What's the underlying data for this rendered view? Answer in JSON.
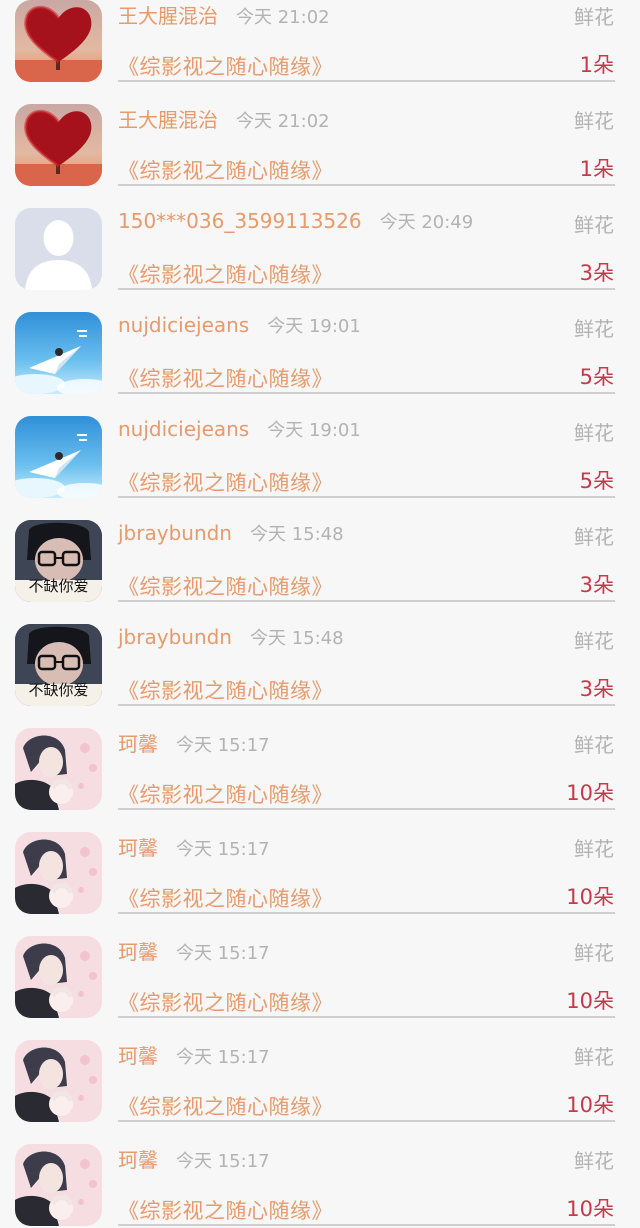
{
  "gift_list": {
    "rows": [
      {
        "user": "王大腥混治",
        "time": "今天 21:02",
        "gift": "鲜花",
        "book": "《综影视之随心随缘》",
        "amount": "1朵",
        "avatar": "heart-tree"
      },
      {
        "user": "王大腥混治",
        "time": "今天 21:02",
        "gift": "鲜花",
        "book": "《综影视之随心随缘》",
        "amount": "1朵",
        "avatar": "heart-tree"
      },
      {
        "user": "150***036_3599113526",
        "time": "今天 20:49",
        "gift": "鲜花",
        "book": "《综影视之随心随缘》",
        "amount": "3朵",
        "avatar": "default-person"
      },
      {
        "user": "nujdiciejeans",
        "time": "今天 19:01",
        "gift": "鲜花",
        "book": "《综影视之随心随缘》",
        "amount": "5朵",
        "avatar": "paper-plane"
      },
      {
        "user": "nujdiciejeans",
        "time": "今天 19:01",
        "gift": "鲜花",
        "book": "《综影视之随心随缘》",
        "amount": "5朵",
        "avatar": "paper-plane"
      },
      {
        "user": "jbraybundn",
        "time": "今天 15:48",
        "gift": "鲜花",
        "book": "《综影视之随心随缘》",
        "amount": "3朵",
        "avatar": "glasses-girl"
      },
      {
        "user": "jbraybundn",
        "time": "今天 15:48",
        "gift": "鲜花",
        "book": "《综影视之随心随缘》",
        "amount": "3朵",
        "avatar": "glasses-girl"
      },
      {
        "user": "珂馨",
        "time": "今天 15:17",
        "gift": "鲜花",
        "book": "《综影视之随心随缘》",
        "amount": "10朵",
        "avatar": "anime-couple"
      },
      {
        "user": "珂馨",
        "time": "今天 15:17",
        "gift": "鲜花",
        "book": "《综影视之随心随缘》",
        "amount": "10朵",
        "avatar": "anime-couple"
      },
      {
        "user": "珂馨",
        "time": "今天 15:17",
        "gift": "鲜花",
        "book": "《综影视之随心随缘》",
        "amount": "10朵",
        "avatar": "anime-couple"
      },
      {
        "user": "珂馨",
        "time": "今天 15:17",
        "gift": "鲜花",
        "book": "《综影视之随心随缘》",
        "amount": "10朵",
        "avatar": "anime-couple"
      },
      {
        "user": "珂馨",
        "time": "今天 15:17",
        "gift": "鲜花",
        "book": "《综影视之随心随缘》",
        "amount": "10朵",
        "avatar": "anime-couple"
      }
    ],
    "avatar_art": {
      "glasses_caption": "不缺你爱"
    }
  },
  "colors": {
    "username": "#e79a6b",
    "book_title": "#e79a6b",
    "amount": "#c8384a",
    "muted": "#b3b3b3",
    "background": "#f7f7f7"
  }
}
